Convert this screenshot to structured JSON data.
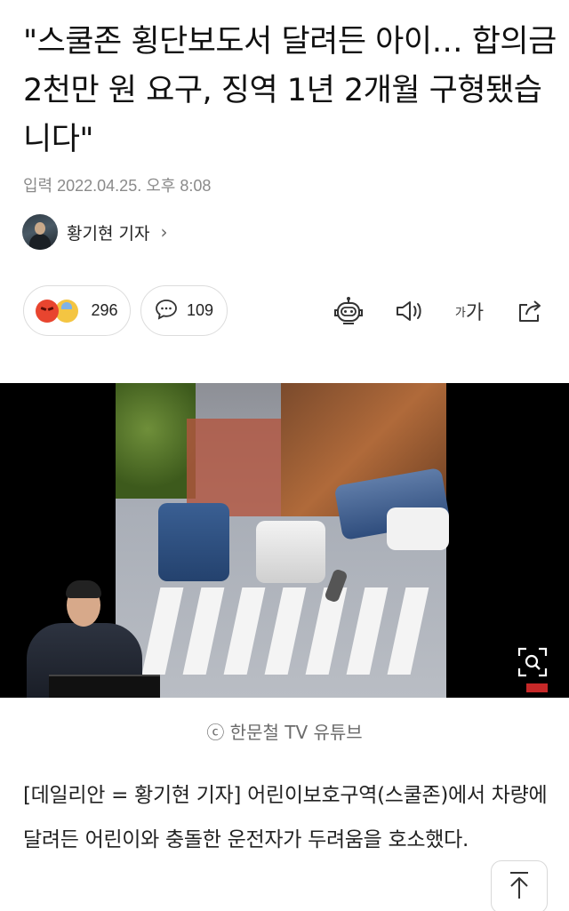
{
  "article": {
    "headline": "\"스쿨존 횡단보도서 달려든 아이… 합의금 2천만 원 요구, 징역 1년 2개월 구형됐습니다\"",
    "date": "입력 2022.04.25. 오후 8:08",
    "reporter": {
      "name": "황기현 기자",
      "chevron": "›"
    }
  },
  "reactions": {
    "count": "296",
    "icons": [
      "angry-face-icon",
      "sad-face-icon"
    ],
    "colors": {
      "angry": "#e8452f",
      "sad": "#f4c542"
    }
  },
  "comments": {
    "count": "109",
    "icon": "speech-bubble-icon"
  },
  "toolbar": {
    "items": [
      "robot-summary-icon",
      "speaker-icon",
      "font-size",
      "share-icon"
    ],
    "font_size_small": "가",
    "font_size_big": "가"
  },
  "media": {
    "caption": "ⓒ 한문철 TV 유튜브",
    "zoom_icon": "zoom-icon"
  },
  "body": {
    "paragraph": "[데일리안 = 황기현 기자] 어린이보호구역(스쿨존)에서 차량에 달려든 어린이와 충돌한 운전자가 두려움을 호소했다."
  },
  "scroll_top": {
    "icon": "arrow-up-icon"
  }
}
